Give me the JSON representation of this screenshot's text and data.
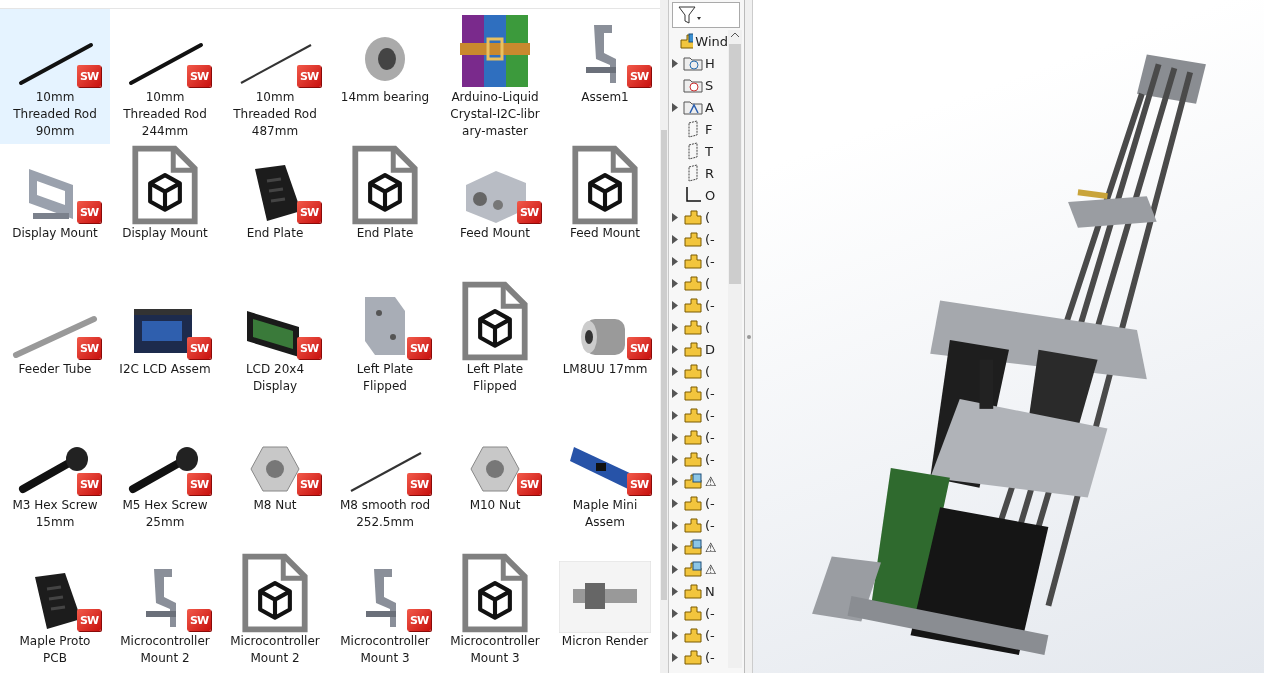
{
  "files": [
    {
      "label": "10mm\nThreaded Rod\n90mm",
      "kind": "rod",
      "badge": "SW",
      "selected": true
    },
    {
      "label": "10mm\nThreaded Rod\n244mm",
      "kind": "rod",
      "badge": "SW",
      "selected": false
    },
    {
      "label": "10mm\nThreaded Rod\n487mm",
      "kind": "thin-rod",
      "badge": "SW",
      "selected": false
    },
    {
      "label": "14mm bearing",
      "kind": "ring",
      "selected": false
    },
    {
      "label": "Arduino-Liquid\nCrystal-I2C-libr\nary-master",
      "kind": "archive",
      "selected": false
    },
    {
      "label": "Assem1",
      "kind": "frame",
      "badge": "SW",
      "selected": false
    },
    {
      "label": "Display Mount",
      "kind": "mount",
      "badge": "SW",
      "selected": false
    },
    {
      "label": "Display Mount",
      "kind": "doc",
      "selected": false
    },
    {
      "label": "End Plate",
      "kind": "black-plate",
      "badge": "SW",
      "selected": false
    },
    {
      "label": "End Plate",
      "kind": "doc",
      "selected": false
    },
    {
      "label": "Feed Mount",
      "kind": "block",
      "badge": "SW",
      "selected": false
    },
    {
      "label": "Feed Mount",
      "kind": "doc",
      "selected": false
    },
    {
      "label": "Feeder Tube",
      "kind": "tube",
      "badge": "SW",
      "selected": false
    },
    {
      "label": "I2C LCD Assem",
      "kind": "board",
      "badge": "SW",
      "selected": false
    },
    {
      "label": "LCD 20x4\nDisplay",
      "kind": "lcd",
      "badge": "SW",
      "selected": false
    },
    {
      "label": "Left Plate\nFlipped",
      "kind": "plate",
      "badge": "SW",
      "selected": false
    },
    {
      "label": "Left Plate\nFlipped",
      "kind": "doc",
      "selected": false
    },
    {
      "label": "LM8UU 17mm",
      "kind": "bushing",
      "badge": "SW",
      "selected": false
    },
    {
      "label": "M3 Hex Screw\n15mm",
      "kind": "screw",
      "badge": "SW",
      "selected": false
    },
    {
      "label": "M5 Hex Screw\n25mm",
      "kind": "screw",
      "badge": "SW",
      "selected": false
    },
    {
      "label": "M8  Nut",
      "kind": "nut",
      "badge": "SW",
      "selected": false
    },
    {
      "label": "M8 smooth rod\n252.5mm",
      "kind": "thin-rod",
      "badge": "SW",
      "selected": false
    },
    {
      "label": "M10  Nut",
      "kind": "nut",
      "badge": "SW",
      "selected": false
    },
    {
      "label": "Maple Mini\nAssem",
      "kind": "blue-board",
      "badge": "SW",
      "selected": false
    },
    {
      "label": "Maple Proto\nPCB",
      "kind": "black-plate",
      "badge": "SW",
      "selected": false
    },
    {
      "label": "Microcontroller\nMount 2",
      "kind": "frame",
      "badge": "SW",
      "selected": false
    },
    {
      "label": "Microcontroller\nMount 2",
      "kind": "doc",
      "selected": false
    },
    {
      "label": "Microcontroller\nMount 3",
      "kind": "frame",
      "badge": "SW",
      "selected": false
    },
    {
      "label": "Microcontroller\nMount 3",
      "kind": "doc",
      "selected": false
    },
    {
      "label": "Micron Render",
      "kind": "render",
      "selected": false
    }
  ],
  "tree": [
    {
      "kind": "assembly",
      "text": "Wind",
      "expander": false
    },
    {
      "kind": "history",
      "text": "H",
      "expander": true
    },
    {
      "kind": "sensor",
      "text": "S",
      "expander": false
    },
    {
      "kind": "annotation",
      "text": "A",
      "expander": true
    },
    {
      "kind": "plane",
      "text": "F",
      "expander": false
    },
    {
      "kind": "plane",
      "text": "T",
      "expander": false
    },
    {
      "kind": "plane",
      "text": "R",
      "expander": false
    },
    {
      "kind": "origin",
      "text": "O",
      "expander": false
    },
    {
      "kind": "part",
      "text": "(",
      "expander": true
    },
    {
      "kind": "part",
      "text": "(-",
      "expander": true
    },
    {
      "kind": "part",
      "text": "(-",
      "expander": true
    },
    {
      "kind": "part",
      "text": "(",
      "expander": true
    },
    {
      "kind": "part",
      "text": "(-",
      "expander": true
    },
    {
      "kind": "part",
      "text": "(",
      "expander": true
    },
    {
      "kind": "part",
      "text": "D",
      "expander": true
    },
    {
      "kind": "part",
      "text": "(",
      "expander": true
    },
    {
      "kind": "part",
      "text": "(-",
      "expander": true
    },
    {
      "kind": "part",
      "text": "(-",
      "expander": true
    },
    {
      "kind": "part",
      "text": "(-",
      "expander": true
    },
    {
      "kind": "part",
      "text": "(-",
      "expander": true
    },
    {
      "kind": "subassembly",
      "text": "⚠",
      "expander": true
    },
    {
      "kind": "part",
      "text": "(-",
      "expander": true
    },
    {
      "kind": "part",
      "text": "(-",
      "expander": true
    },
    {
      "kind": "subassembly",
      "text": "⚠",
      "expander": true
    },
    {
      "kind": "subassembly",
      "text": "⚠",
      "expander": true
    },
    {
      "kind": "part",
      "text": "N",
      "expander": true
    },
    {
      "kind": "part",
      "text": "(-",
      "expander": true
    },
    {
      "kind": "part",
      "text": "(-",
      "expander": true
    },
    {
      "kind": "part",
      "text": "(-",
      "expander": true
    }
  ]
}
